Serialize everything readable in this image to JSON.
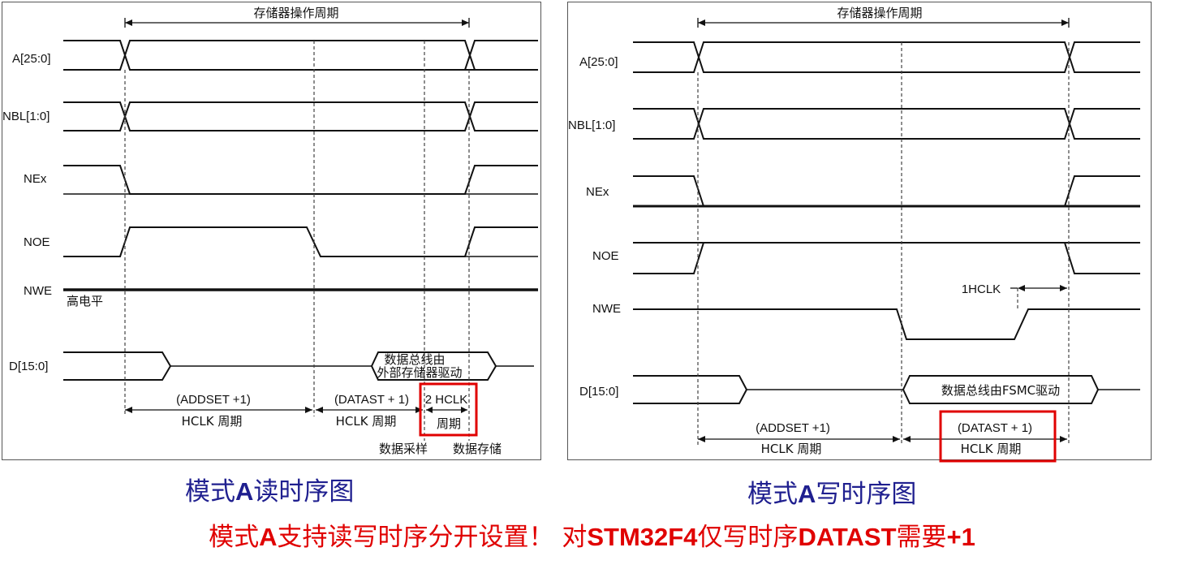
{
  "read_diagram": {
    "cycle_label": "存储器操作周期",
    "signals": [
      "A[25:0]",
      "NBL[1:0]",
      "NEx",
      "NOE",
      "NWE",
      "D[15:0]"
    ],
    "nwe_note": "高电平",
    "data_bus_line1": "数据总线由",
    "data_bus_line2": "外部存储器驱动",
    "addset_line1": "(ADDSET +1)",
    "addset_line2": "HCLK 周期",
    "datast_line1": "(DATAST + 1)",
    "datast_line2": "HCLK 周期",
    "hclk2_line1": "2 HCLK",
    "hclk2_line2": "周期",
    "sample_label": "数据采样",
    "store_label": "数据存储"
  },
  "write_diagram": {
    "cycle_label": "存储器操作周期",
    "signals": [
      "A[25:0]",
      "NBL[1:0]",
      "NEx",
      "NOE",
      "NWE",
      "D[15:0]"
    ],
    "hclk1_label": "1HCLK",
    "data_bus_label": "数据总线由FSMC驱动",
    "addset_line1": "(ADDSET +1)",
    "addset_line2": "HCLK 周期",
    "datast_line1": "(DATAST + 1)",
    "datast_line2": "HCLK 周期"
  },
  "captions": {
    "read": {
      "pre": "模式",
      "bold": "A",
      "post": "读时序图"
    },
    "write": {
      "pre": "模式",
      "bold": "A",
      "post": "写时序图"
    }
  },
  "note": {
    "p1": "模式",
    "b1": "A",
    "p2": "支持读写时序分开设置！ 对",
    "b2": "STM32F4",
    "p3": "仅写时序",
    "b3": "DATAST",
    "p4": "需要",
    "b4": "+1"
  },
  "colors": {
    "highlight": "#e00000",
    "caption": "#1f1f8f",
    "line": "#111111"
  }
}
